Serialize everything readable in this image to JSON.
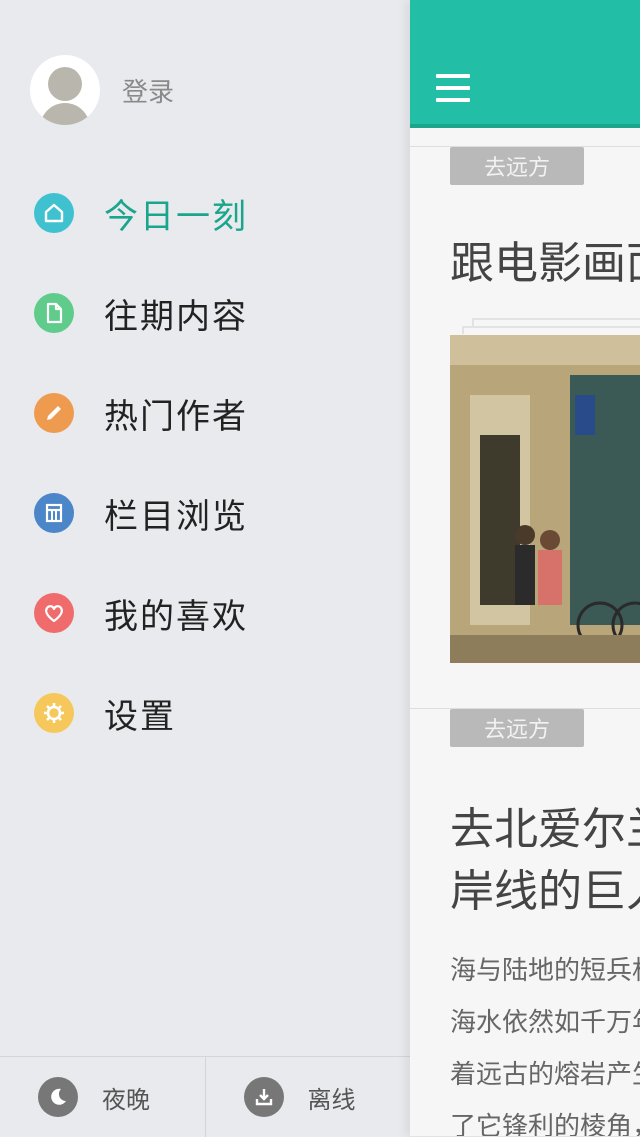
{
  "drawer": {
    "login_label": "登录",
    "menu": [
      {
        "label": "今日一刻",
        "icon": "home-icon",
        "color": "#3fc1cf",
        "active": true
      },
      {
        "label": "往期内容",
        "icon": "document-icon",
        "color": "#5fcc8b"
      },
      {
        "label": "热门作者",
        "icon": "pencil-icon",
        "color": "#ef9b4f"
      },
      {
        "label": "栏目浏览",
        "icon": "calendar-icon",
        "color": "#4a86c8"
      },
      {
        "label": "我的喜欢",
        "icon": "heart-icon",
        "color": "#f06b6b"
      },
      {
        "label": "设置",
        "icon": "gear-icon",
        "color": "#f6c85b"
      }
    ],
    "bottom": {
      "night_label": "夜晚",
      "offline_label": "离线"
    },
    "colors": {
      "active": "#1aa58c"
    }
  },
  "content": {
    "topbar_color": "#22bea5",
    "cards": [
      {
        "tag": "去远方",
        "title": "跟电影画面"
      },
      {
        "tag": "去远方",
        "title_lines": [
          "去北爱尔兰",
          "岸线的巨人"
        ],
        "excerpt_lines": [
          "海与陆地的短兵相",
          "海水依然如千万年",
          "着远古的熔岩产生",
          "了它锋利的棱角，"
        ]
      }
    ]
  }
}
